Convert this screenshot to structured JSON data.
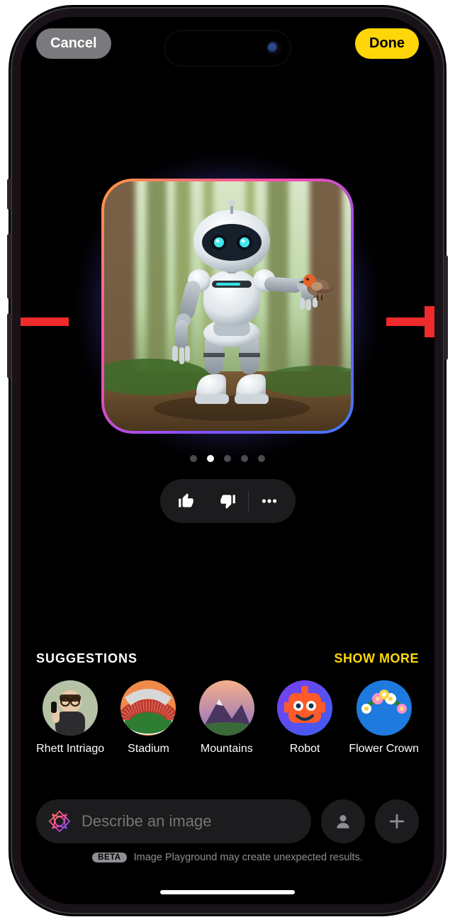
{
  "topbar": {
    "cancel": "Cancel",
    "done": "Done"
  },
  "pager": {
    "count": 5,
    "active_index": 1
  },
  "suggestions": {
    "heading": "SUGGESTIONS",
    "show_more": "SHOW MORE",
    "items": [
      {
        "label": "Rhett Intriago"
      },
      {
        "label": "Stadium"
      },
      {
        "label": "Mountains"
      },
      {
        "label": "Robot"
      },
      {
        "label": "Flower Crown"
      }
    ]
  },
  "prompt": {
    "placeholder": "Describe an image"
  },
  "footer": {
    "beta_badge": "BETA",
    "disclaimer": "Image Playground may create unexpected results."
  }
}
